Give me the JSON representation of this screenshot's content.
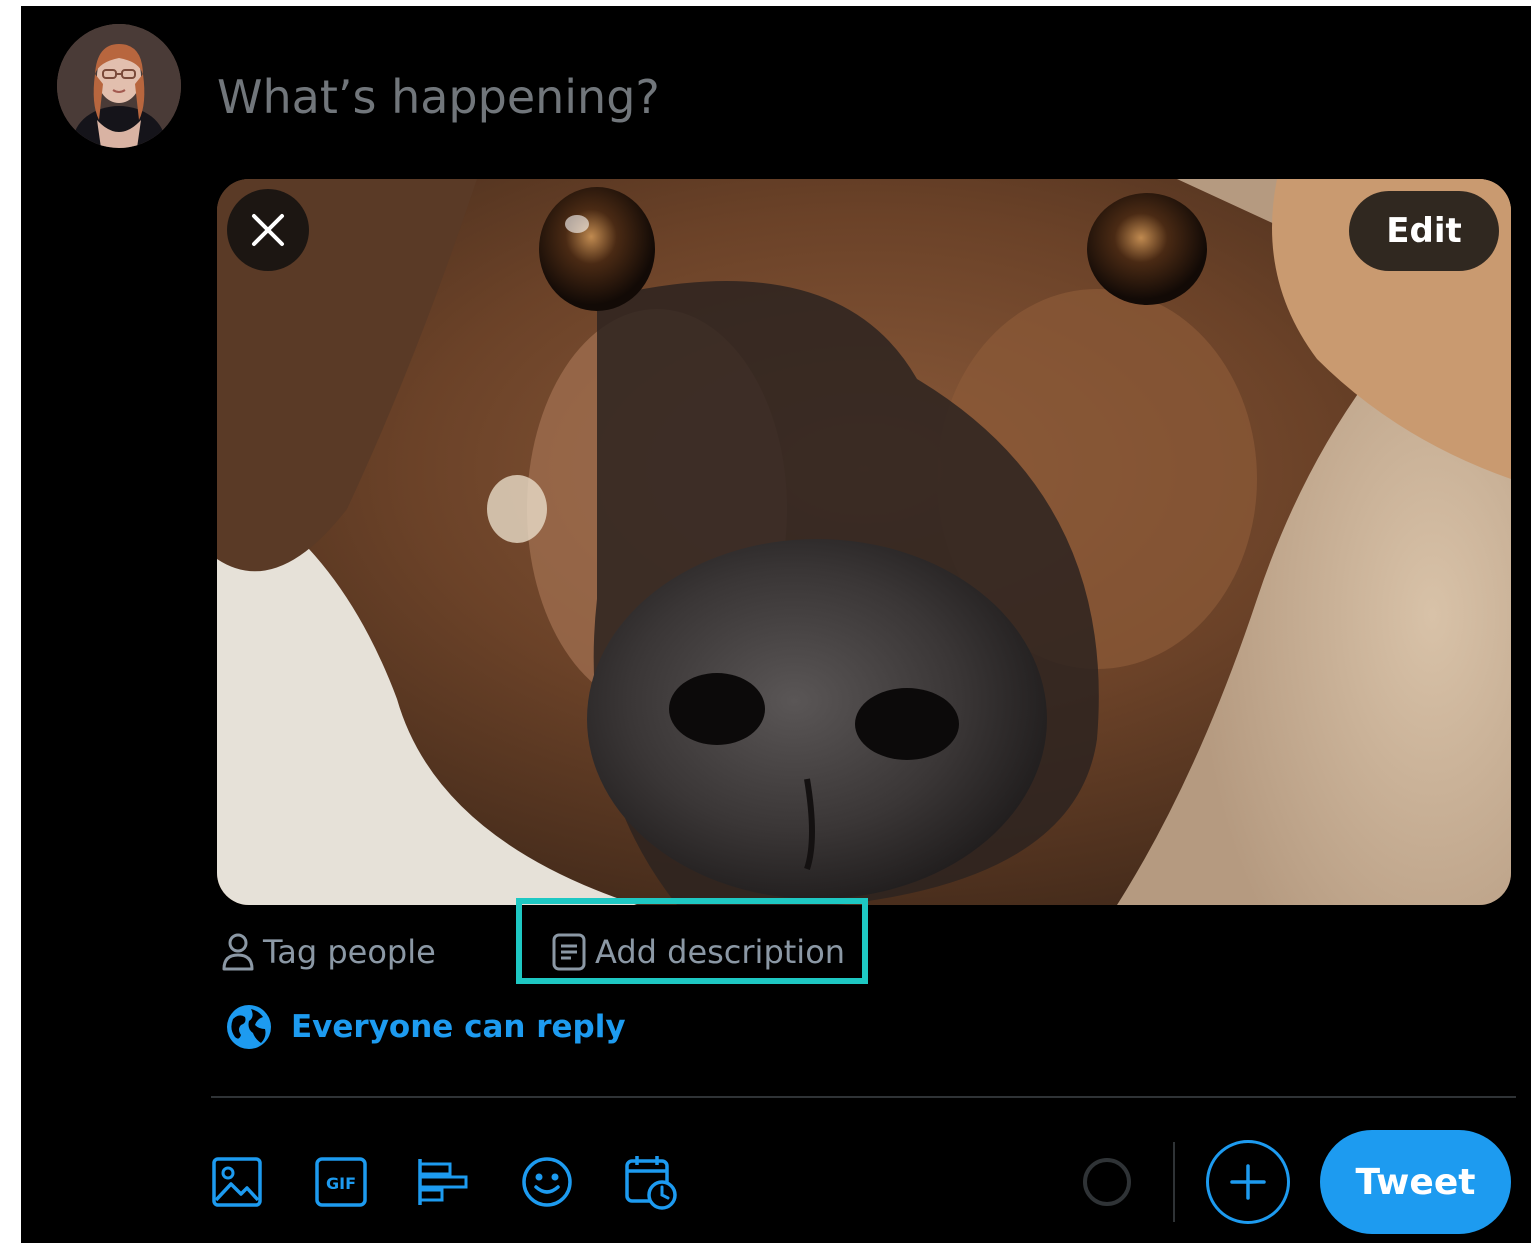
{
  "composer": {
    "placeholder": "What’s happening?",
    "avatar_icon": "user-avatar-photo"
  },
  "media": {
    "remove_icon": "close-icon",
    "edit_label": "Edit",
    "tag_people_label": "Tag people",
    "add_description_label": "Add description"
  },
  "reply": {
    "label": "Everyone can reply",
    "icon": "globe-icon"
  },
  "toolbar": {
    "icons": [
      "image-icon",
      "gif-icon",
      "poll-icon",
      "emoji-icon",
      "schedule-icon"
    ],
    "gif_text": "GIF",
    "tweet_label": "Tweet"
  },
  "colors": {
    "background": "#000000",
    "accent": "#1d9bf0",
    "highlight": "#1ec8c3",
    "muted_text": "#8b98a5",
    "placeholder": "#71767b"
  }
}
